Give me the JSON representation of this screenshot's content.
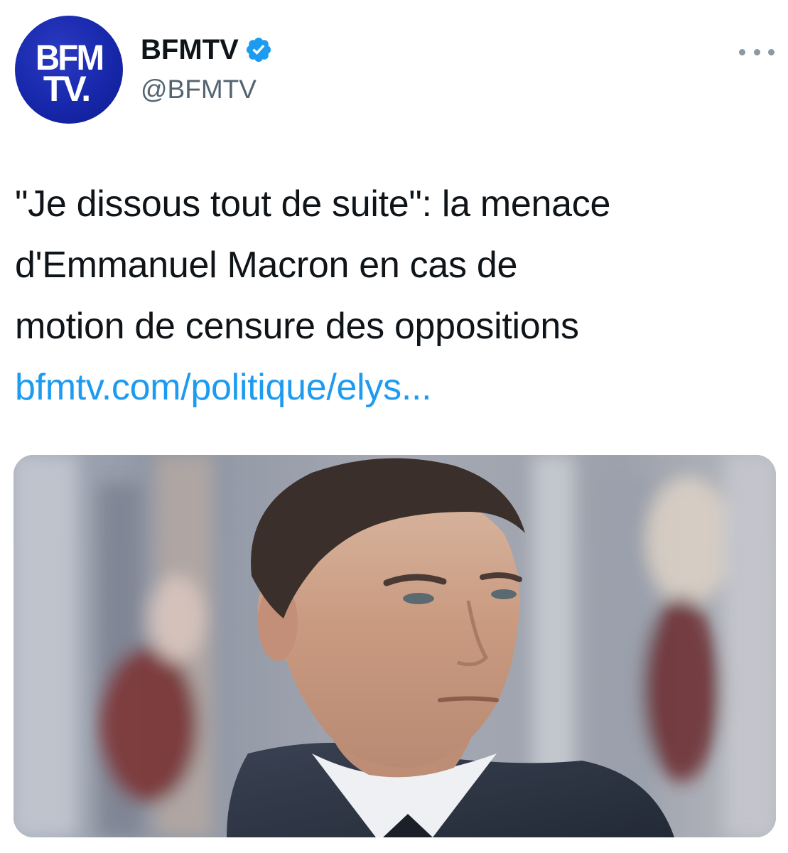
{
  "author": {
    "logo_text_line1": "BFM",
    "logo_text_line2": "TV.",
    "display_name": "BFMTV",
    "handle": "@BFMTV",
    "verified": true,
    "verified_icon": "verified-badge-icon",
    "more_icon": "more-options-icon"
  },
  "tweet": {
    "text_lines": [
      "\"Je dissous tout de suite\": la menace",
      "d'Emmanuel Macron en cas de",
      "motion de censure des oppositions"
    ],
    "link_text": "bfmtv.com/politique/elys..."
  },
  "media": {
    "type": "photo",
    "icon": "photo-thumbnail"
  },
  "colors": {
    "brand_blue": "#1626a8",
    "link_blue": "#1d9bf0",
    "verified_blue": "#1d9bf0",
    "text": "#0f1419",
    "secondary_text": "#536471"
  }
}
